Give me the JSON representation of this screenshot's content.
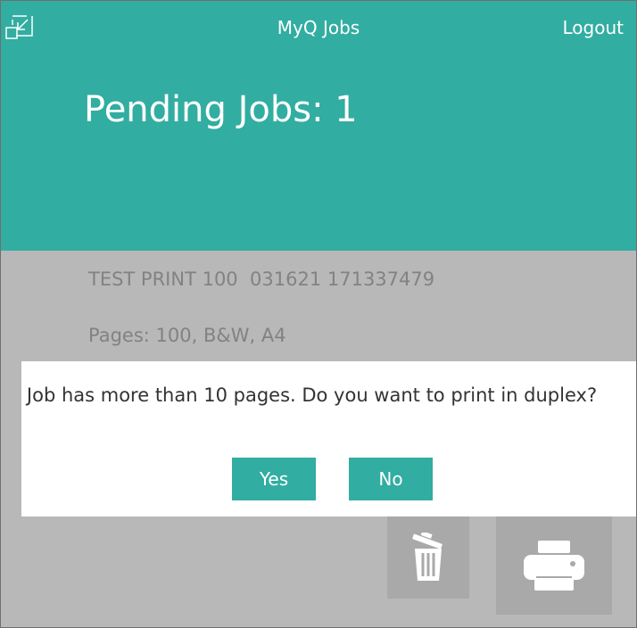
{
  "header": {
    "app_title": "MyQ Jobs",
    "logout_label": "Logout",
    "pending_title": "Pending Jobs: 1",
    "minimize_icon": "minimize-window-icon"
  },
  "job": {
    "name": "TEST PRINT 100  031621 171337479",
    "info": "Pages: 100, B&W, A4"
  },
  "actions": {
    "delete_icon": "trash-icon",
    "print_icon": "printer-icon"
  },
  "dialog": {
    "message": "Job has more than 10 pages. Do you want to print in duplex?",
    "yes_label": "Yes",
    "no_label": "No"
  },
  "colors": {
    "accent": "#32ada1",
    "overlay_gray": "#b8b8b8",
    "button_gray": "#a9a9a9"
  }
}
